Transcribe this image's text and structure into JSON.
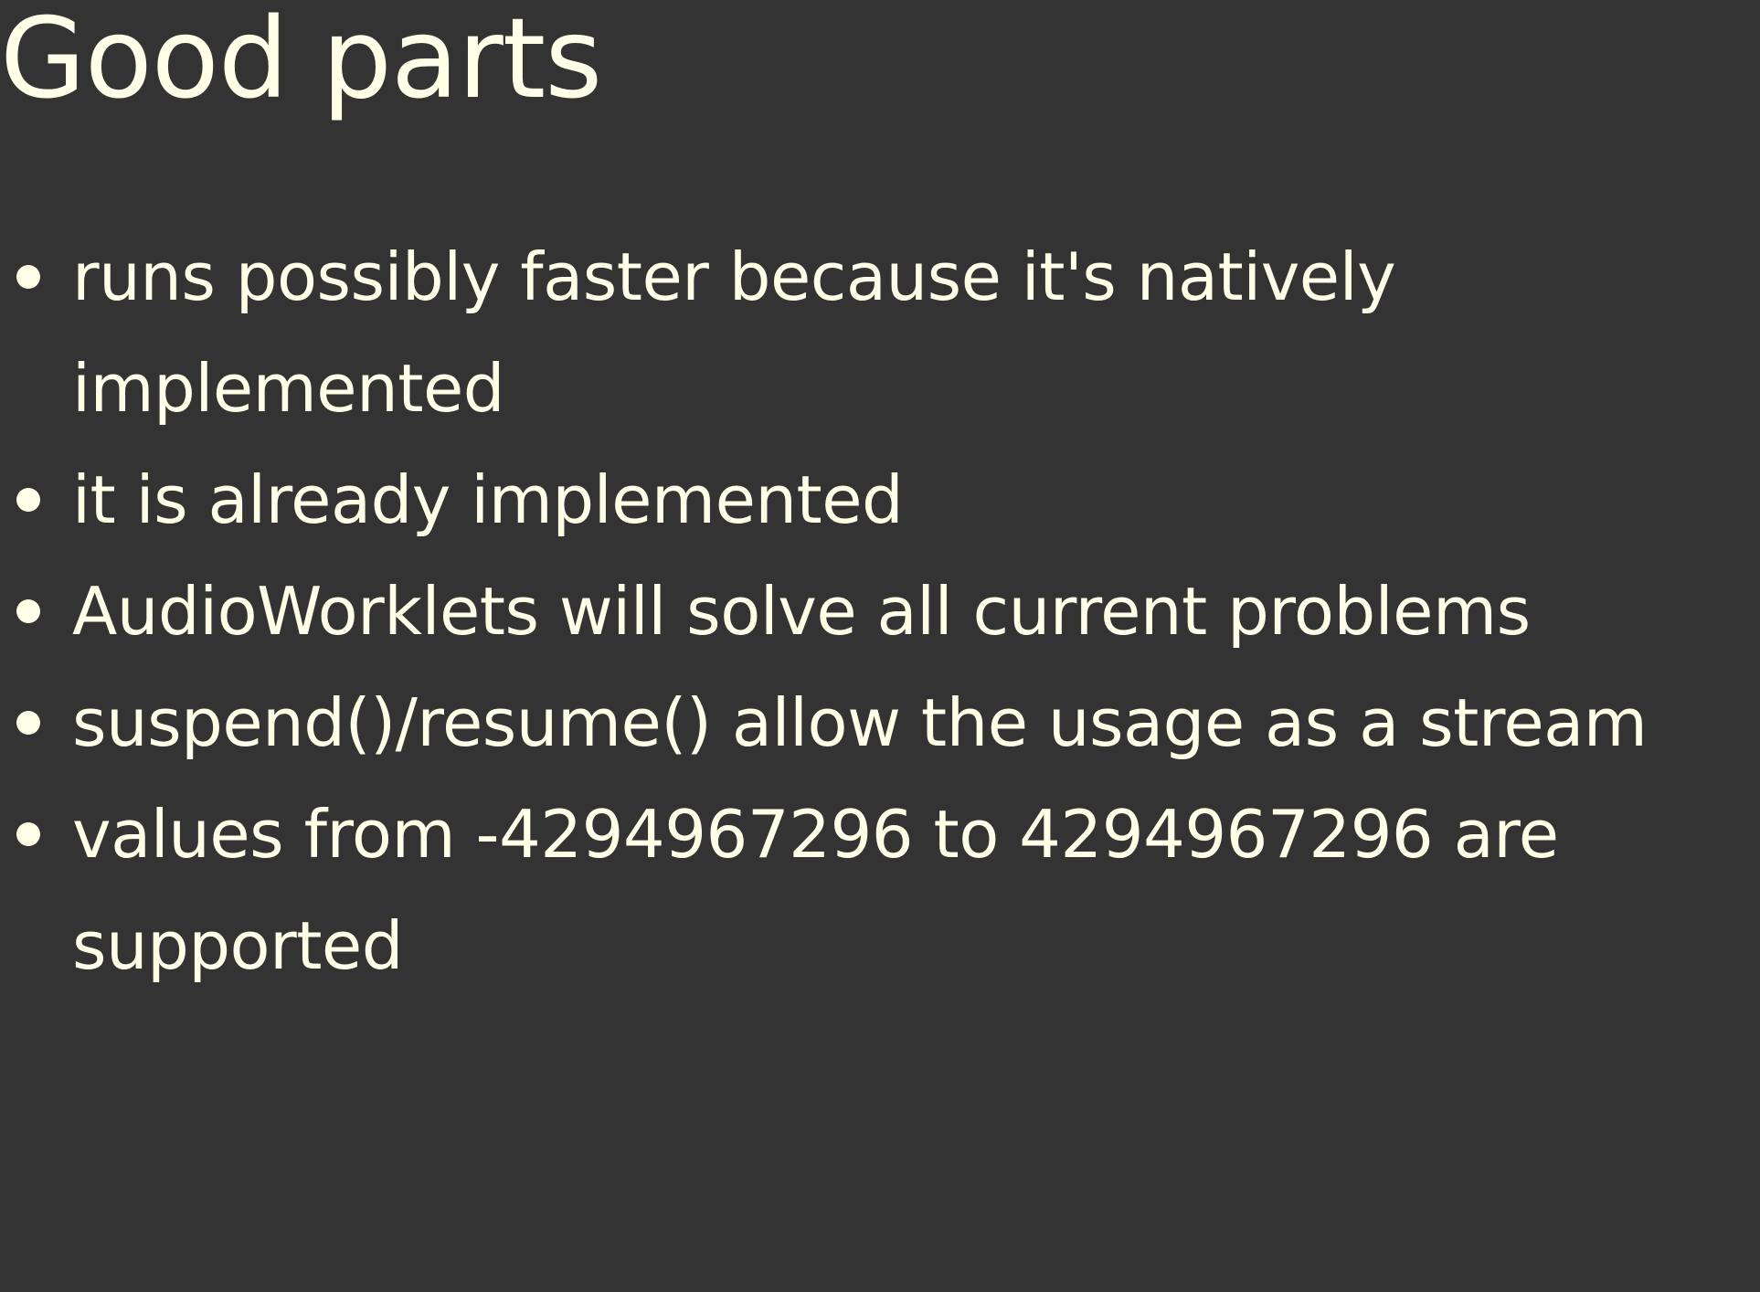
{
  "slide": {
    "title": "Good parts",
    "bullets": [
      {
        "text": "runs possibly faster because it's natively implemented"
      },
      {
        "text": "it is already implemented"
      },
      {
        "text": "AudioWorklets will solve all current problems"
      },
      {
        "text": "suspend()/resume() allow the usage as a stream"
      },
      {
        "text": "values from -4294967296 to 4294967296 are supported"
      }
    ]
  },
  "colors": {
    "background": "#333333",
    "text": "#FFFFE8"
  }
}
